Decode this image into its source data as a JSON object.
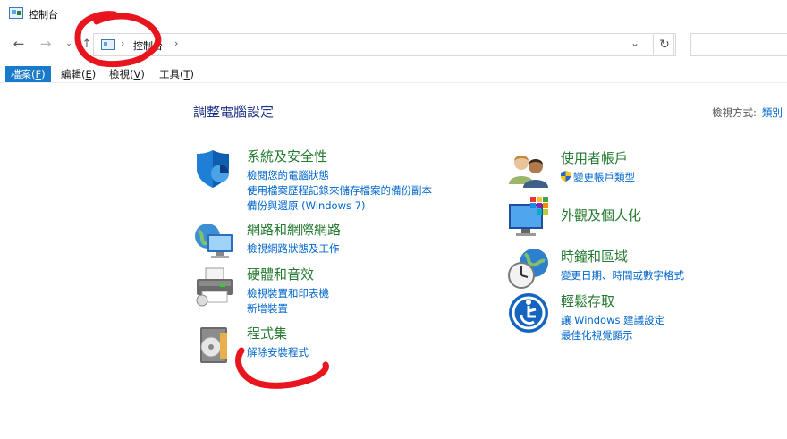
{
  "window": {
    "title": "控制台"
  },
  "address": {
    "crumb": "控制台"
  },
  "menu": [
    {
      "label": "檔案",
      "key": "F"
    },
    {
      "label": "編輯",
      "key": "E"
    },
    {
      "label": "檢視",
      "key": "V"
    },
    {
      "label": "工具",
      "key": "T"
    }
  ],
  "main": {
    "heading": "調整電腦設定",
    "view_by_label": "檢視方式:",
    "view_by_value": "類別"
  },
  "categories_left": [
    {
      "title": "系統及安全性",
      "icon": "shield-icon",
      "links": [
        "檢閱您的電腦狀態",
        "使用檔案歷程記錄來儲存檔案的備份副本",
        "備份與還原 (Windows 7)"
      ]
    },
    {
      "title": "網路和網際網路",
      "icon": "network-icon",
      "links": [
        "檢視網路狀態及工作"
      ]
    },
    {
      "title": "硬體和音效",
      "icon": "printer-icon",
      "links": [
        "檢視裝置和印表機",
        "新增裝置"
      ]
    },
    {
      "title": "程式集",
      "icon": "programs-icon",
      "links": [
        "解除安裝程式"
      ]
    }
  ],
  "categories_right": [
    {
      "title": "使用者帳戶",
      "icon": "users-icon",
      "links": [
        "變更帳戶類型"
      ]
    },
    {
      "title": "外觀及個人化",
      "icon": "monitor-icon",
      "links": []
    },
    {
      "title": "時鐘和區域",
      "icon": "clock-globe-icon",
      "links": [
        "變更日期、時間或數字格式"
      ]
    },
    {
      "title": "輕鬆存取",
      "icon": "ease-of-access-icon",
      "links": [
        "讓 Windows 建議設定",
        "最佳化視覺顯示"
      ]
    }
  ],
  "colors": {
    "accent": "#1979ca",
    "category_title": "#247a30",
    "link": "#0066cc",
    "heading": "#1e3287",
    "annotation": "#e8141e"
  }
}
